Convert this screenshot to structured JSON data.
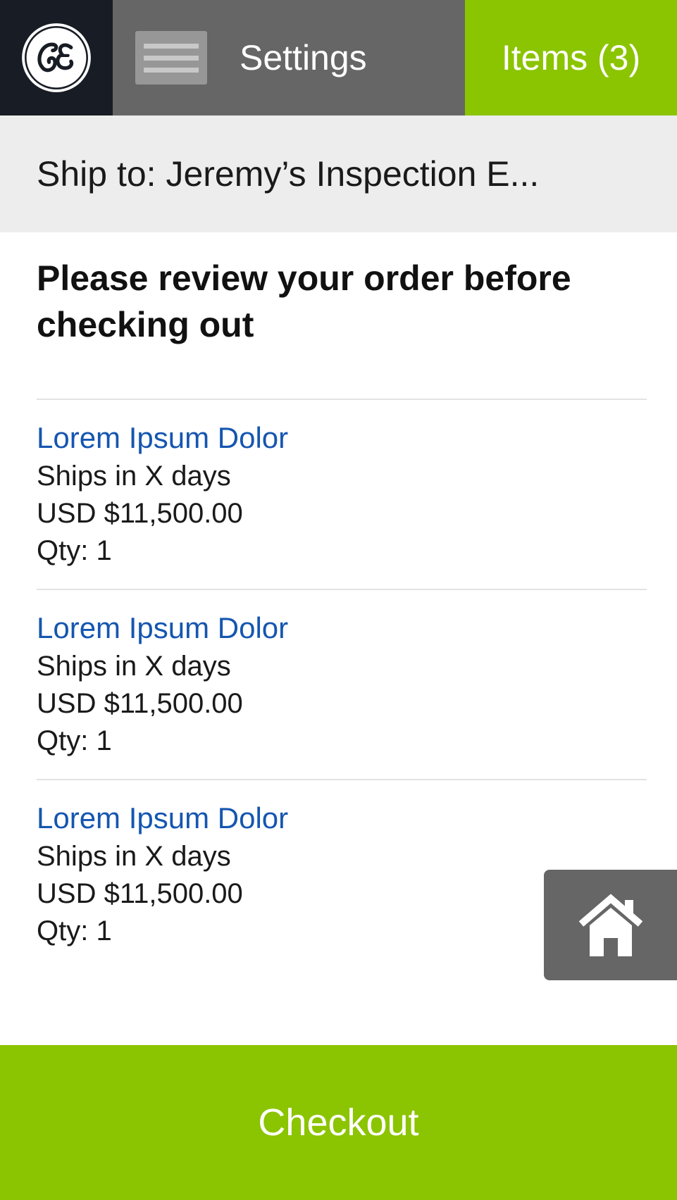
{
  "header": {
    "logo_icon": "ge-logo-icon",
    "menu_icon": "hamburger-menu-icon",
    "settings_label": "Settings",
    "items_label": "Items (3)",
    "colors": {
      "logo_bg": "#181c24",
      "settings_bg": "#666666",
      "accent": "#8bc400"
    }
  },
  "ship_to": {
    "text": "Ship to: Jeremy’s Inspection E..."
  },
  "review_heading": "Please review your order before checking out",
  "items": [
    {
      "name": "Lorem Ipsum Dolor",
      "ships": "Ships in X days",
      "price": "USD $11,500.00",
      "qty": "Qty: 1"
    },
    {
      "name": "Lorem Ipsum Dolor",
      "ships": "Ships in X days",
      "price": "USD $11,500.00",
      "qty": "Qty: 1"
    },
    {
      "name": "Lorem Ipsum Dolor",
      "ships": "Ships in X days",
      "price": "USD $11,500.00",
      "qty": "Qty: 1"
    }
  ],
  "home_button": {
    "icon": "home-icon"
  },
  "checkout_label": "Checkout",
  "colors": {
    "link": "#1556b0",
    "divider": "#e3e3e3",
    "ship_bg": "#ededed"
  }
}
